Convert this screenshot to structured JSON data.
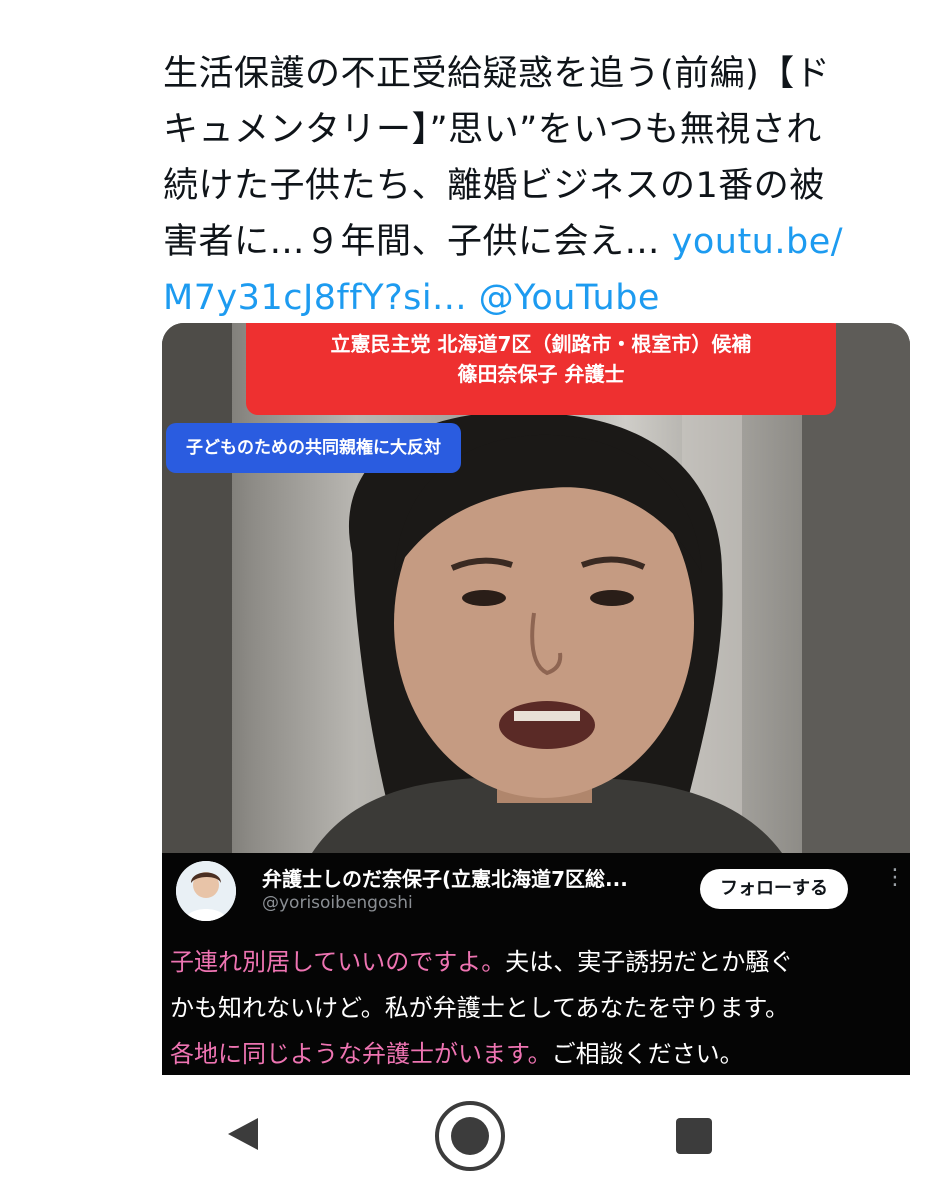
{
  "tweet": {
    "text_line1": "生活保護の不正受給疑惑を追う(前編)【ド",
    "text_line2": "キュメンタリー】”思い”をいつも無視され",
    "text_line3": "続けた子供たち、離婚ビジネスの1番の被",
    "text_line4_prefix": "害者に…９年間、子供に会え… ",
    "link_line4": "youtu.be/",
    "link_line5": "M7y31cJ8ffY?si...",
    "mention": "@YouTube",
    "link_color": "#1d9bf0"
  },
  "media": {
    "red_banner_line1": "立憲民主党 北海道7区（釧路市・根室市）候補",
    "red_banner_line2": "篠田奈保子 弁護士",
    "blue_banner": "子どものための共同親権に大反対",
    "embedded_post": {
      "display_name": "弁護士しのだ奈保子(立憲北海道7区総...",
      "handle": "@yorisoibengoshi",
      "follow_label": "フォローする",
      "more_icon": "⋮",
      "line1_pink": "子連れ別居していいのですよ。",
      "line1_white": "夫は、実子誘拐だとか騒ぐ",
      "line2_white": "かも知れないけど。私が弁護士としてあなたを守ります。",
      "line3_pink": "各地に同じような弁護士がいます。",
      "line3_white": "ご相談ください。"
    },
    "colors": {
      "red_banner": "#ee3030",
      "blue_banner": "#2a5ce0",
      "pink_text": "#ee74b2"
    }
  },
  "nav": {
    "back_icon": "triangle-back-icon",
    "home_icon": "circle-home-icon",
    "recents_icon": "square-recents-icon"
  }
}
